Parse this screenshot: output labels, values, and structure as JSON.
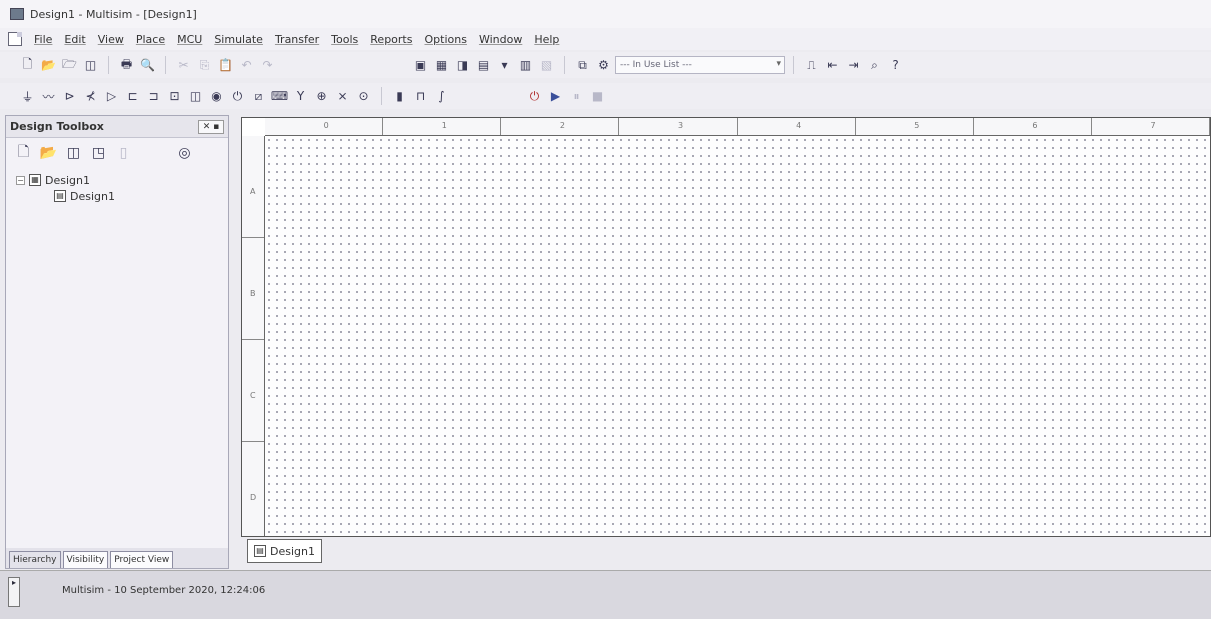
{
  "window": {
    "title": "Design1 - Multisim - [Design1]"
  },
  "menu": [
    "File",
    "Edit",
    "View",
    "Place",
    "MCU",
    "Simulate",
    "Transfer",
    "Tools",
    "Reports",
    "Options",
    "Window",
    "Help"
  ],
  "toolbar": {
    "in_use_list": "--- In Use List ---"
  },
  "design_toolbox": {
    "title": "Design Toolbox",
    "tree": {
      "root": "Design1",
      "child": "Design1"
    },
    "tabs": [
      "Hierarchy",
      "Visibility",
      "Project View"
    ]
  },
  "rulers": {
    "top": [
      "0",
      "1",
      "2",
      "3",
      "4",
      "5",
      "6",
      "7"
    ],
    "left": [
      "A",
      "B",
      "C",
      "D"
    ]
  },
  "canvas": {
    "tab": "Design1"
  },
  "status": {
    "message": "Multisim  -  10 September 2020, 12:24:06"
  }
}
